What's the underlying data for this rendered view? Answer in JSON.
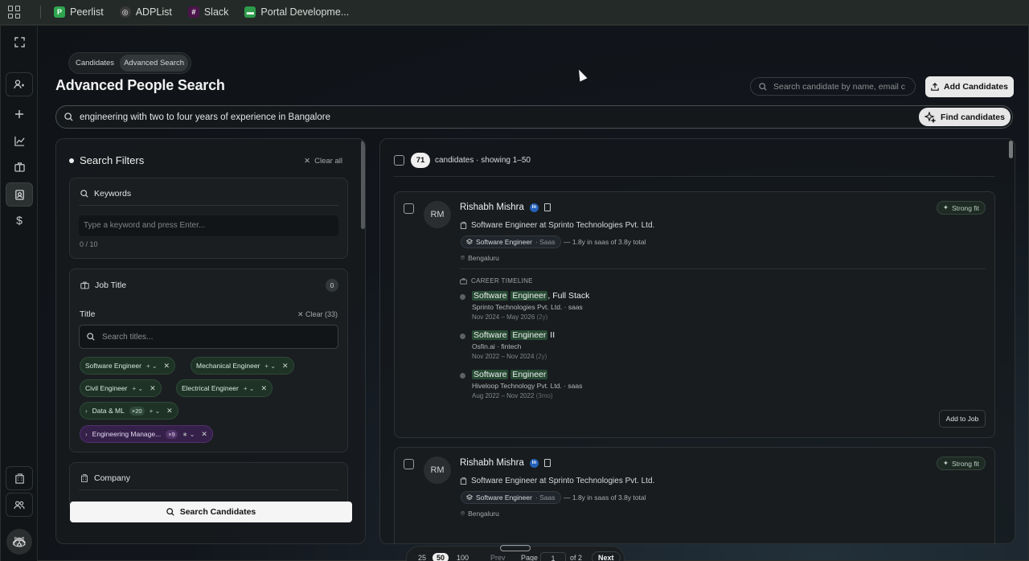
{
  "bookmarks": [
    {
      "label": "Peerlist",
      "icon": "P",
      "color": "#2fa44f"
    },
    {
      "label": "ADPList",
      "icon": "◎",
      "color": "#3a3a3a"
    },
    {
      "label": "Slack",
      "icon": "#",
      "color": "#4a154b"
    },
    {
      "label": "Portal Developme...",
      "icon": "▬",
      "color": "#2d9b4a"
    }
  ],
  "breadcrumbs": [
    "Candidates",
    "Advanced Search"
  ],
  "page_title": "Advanced People Search",
  "top_search": {
    "placeholder": "Search candidate by name, email c"
  },
  "add_candidates_label": "Add Candidates",
  "main_search": {
    "value": "engineering with two to four years of experience in Bangalore"
  },
  "find_candidates_label": "Find candidates",
  "filters": {
    "title": "Search Filters",
    "clear_all": "Clear all",
    "keywords": {
      "title": "Keywords",
      "placeholder": "Type a keyword and press Enter...",
      "count": "0 / 10"
    },
    "job_title": {
      "title": "Job Title",
      "badge": "0",
      "sub_label": "Title",
      "clear": "Clear (33)",
      "placeholder": "Search titles...",
      "chips": [
        {
          "label": "Software Engineer",
          "ctl": "+ ⌄"
        },
        {
          "label": "Mechanical Engineer",
          "ctl": "+ ⌄"
        },
        {
          "label": "Civil Engineer",
          "ctl": "+ ⌄"
        },
        {
          "label": "Electrical Engineer",
          "ctl": "+ ⌄"
        },
        {
          "label": "Data & ML",
          "count": "×20",
          "ctl": "+ ⌄"
        },
        {
          "label": "Engineering Manage...",
          "count": "×9",
          "ctl": "∗ ⌄"
        }
      ]
    },
    "company": {
      "title": "Company"
    },
    "search_button": "Search Candidates"
  },
  "results": {
    "count": "71",
    "info": "candidates · showing 1–50",
    "candidates": [
      {
        "initials": "RM",
        "name": "Rishabh Mishra",
        "title": "Software Engineer at Sprinto Technologies Pvt. Ltd.",
        "skill": "Software Engineer",
        "skill_tag": "· Saas",
        "exp": "— 1.8y in saas of 3.8y total",
        "location": "Bengaluru",
        "fit": "Strong fit",
        "timeline_head": "CAREER TIMELINE",
        "timeline": [
          {
            "hl1": "Software",
            "hl2": "Engineer",
            "rest": ", Full Stack",
            "company": "Sprinto Technologies Pvt. Ltd. · saas",
            "dates": "Nov 2024 – May 2026",
            "dur": "(2y)"
          },
          {
            "hl1": "Software",
            "hl2": "Engineer",
            "rest": " II",
            "company": "Osfin.ai · fintech",
            "dates": "Nov 2022 – Nov 2024",
            "dur": "(2y)"
          },
          {
            "hl1": "Software",
            "hl2": "Engineer",
            "rest": "",
            "company": "Hiveloop Technology Pvt. Ltd. · saas",
            "dates": "Aug 2022 – Nov 2022",
            "dur": "(3mo)"
          }
        ],
        "add_to_job": "Add to Job"
      },
      {
        "initials": "RM",
        "name": "Rishabh Mishra",
        "title": "Software Engineer at Sprinto Technologies Pvt. Ltd.",
        "skill": "Software Engineer",
        "skill_tag": "· Saas",
        "exp": "— 1.8y in saas of 3.8y total",
        "location": "Bengaluru",
        "fit": "Strong fit"
      }
    ]
  },
  "pager": {
    "sizes": [
      "25",
      "50",
      "100"
    ],
    "selected": "50",
    "prev": "Prev",
    "page_label": "Page",
    "page": "1",
    "of": "of 2",
    "next": "Next"
  }
}
